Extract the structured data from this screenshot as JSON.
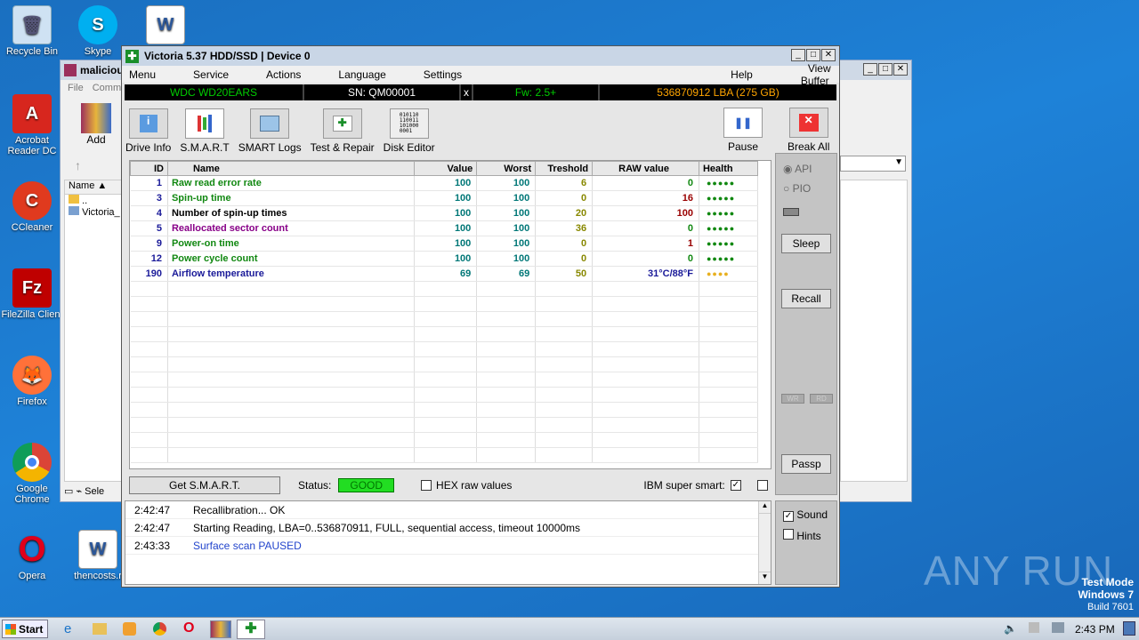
{
  "desktop": {
    "icons": [
      {
        "label": "Recycle Bin",
        "icon": "recycle-bin-icon"
      },
      {
        "label": "Skype",
        "icon": "skype-icon"
      },
      {
        "label": "Acrobat Reader DC",
        "icon": "acrobat-icon"
      },
      {
        "label": "CCleaner",
        "icon": "ccleaner-icon"
      },
      {
        "label": "FileZilla Client",
        "icon": "filezilla-icon"
      },
      {
        "label": "Firefox",
        "icon": "firefox-icon"
      },
      {
        "label": "Google Chrome",
        "icon": "chrome-icon"
      },
      {
        "label": "Opera",
        "icon": "opera-icon"
      },
      {
        "label": "thencosts.r",
        "icon": "word-doc-icon"
      }
    ],
    "watermark": "ANY RUN",
    "test_mode": {
      "line1": "Test Mode",
      "line2": "Windows 7",
      "line3": "Build 7601"
    }
  },
  "bg_window": {
    "title": "maliciou",
    "menu": [
      "File",
      "Comma"
    ],
    "add_label": "Add",
    "column_name": "Name",
    "items": [
      "..",
      "Victoria_"
    ],
    "status": "Sele"
  },
  "victoria": {
    "title": "Victoria 5.37 HDD/SSD | Device 0",
    "menu": [
      "Menu",
      "Service",
      "Actions",
      "Language",
      "Settings"
    ],
    "help": "Help",
    "view_buffer": "View Buffer Live",
    "info": {
      "model": "WDC WD20EARS",
      "serial": "SN: QM00001",
      "close": "x",
      "firmware": "Fw: 2.5+",
      "lba": "536870912 LBA (275 GB)"
    },
    "toolbar": [
      "Drive Info",
      "S.M.A.R.T",
      "SMART Logs",
      "Test & Repair",
      "Disk Editor"
    ],
    "pause_label": "Pause",
    "break_label": "Break All",
    "columns": [
      "ID",
      "Name",
      "Value",
      "Worst",
      "Treshold",
      "RAW value",
      "Health"
    ],
    "rows": [
      {
        "id": "1",
        "name": "Raw read error rate",
        "value": "100",
        "worst": "100",
        "thresh": "6",
        "raw": "0",
        "health": "●●●●●"
      },
      {
        "id": "3",
        "name": "Spin-up time",
        "value": "100",
        "worst": "100",
        "thresh": "0",
        "raw": "16",
        "health": "●●●●●"
      },
      {
        "id": "4",
        "name": "Number of spin-up times",
        "value": "100",
        "worst": "100",
        "thresh": "20",
        "raw": "100",
        "health": "●●●●●"
      },
      {
        "id": "5",
        "name": "Reallocated sector count",
        "value": "100",
        "worst": "100",
        "thresh": "36",
        "raw": "0",
        "health": "●●●●●"
      },
      {
        "id": "9",
        "name": "Power-on time",
        "value": "100",
        "worst": "100",
        "thresh": "0",
        "raw": "1",
        "health": "●●●●●"
      },
      {
        "id": "12",
        "name": "Power cycle count",
        "value": "100",
        "worst": "100",
        "thresh": "0",
        "raw": "0",
        "health": "●●●●●"
      },
      {
        "id": "190",
        "name": "Airflow temperature",
        "value": "69",
        "worst": "69",
        "thresh": "50",
        "raw": "31°C/88°F",
        "health": "●●●●"
      }
    ],
    "bottom": {
      "get_smart": "Get S.M.A.R.T.",
      "status_label": "Status:",
      "status_value": "GOOD",
      "hex_label": "HEX raw values",
      "ibm_label": "IBM super smart:"
    },
    "side": {
      "api": "API",
      "pio": "PIO",
      "sleep": "Sleep",
      "recall": "Recall",
      "wr": "WR",
      "rd": "RD",
      "passp": "Passp"
    },
    "log": [
      {
        "time": "2:42:47",
        "text": "Recallibration... OK"
      },
      {
        "time": "2:42:47",
        "text": "Starting Reading, LBA=0..536870911, FULL, sequential access, timeout 10000ms"
      },
      {
        "time": "2:43:33",
        "text": "Surface scan PAUSED"
      }
    ],
    "sound_label": "Sound",
    "hints_label": "Hints"
  },
  "taskbar": {
    "start": "Start",
    "clock": "2:43 PM"
  }
}
